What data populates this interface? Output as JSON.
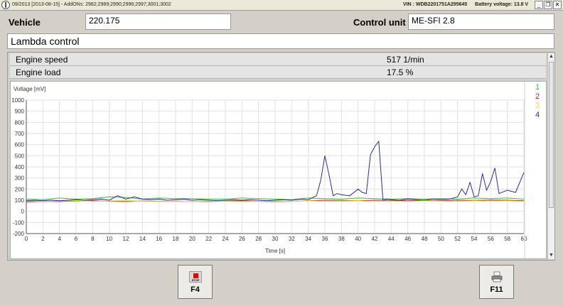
{
  "window": {
    "title": "09/2013 [2013-08-15] - AddONs: 2982;2989;2990;2996;2997;3001;3002",
    "vin": "VIN : WDB2201751A295645",
    "battery": "Battery voltage: 13.8 V"
  },
  "header": {
    "vehicle_label": "Vehicle",
    "vehicle_value": "220.175",
    "control_unit_label": "Control unit",
    "control_unit_value": "ME-SFI 2.8",
    "section_title": "Lambda control"
  },
  "readings": [
    {
      "name": "Engine speed",
      "value": "517 1/min"
    },
    {
      "name": "Engine load",
      "value": "17.5 %"
    }
  ],
  "buttons": {
    "f4_label": "F4",
    "f4_icon_text": "STOP",
    "f11_label": "F11"
  },
  "colors": {
    "series1": "#22cc22",
    "series2": "#cc2222",
    "series3": "#e8e800",
    "series4": "#2a2aa8"
  },
  "chart_data": {
    "type": "line",
    "ylabel": "Voltage [mV]",
    "xlabel": "Time [s]",
    "xlim": [
      0,
      60
    ],
    "ylim": [
      -200,
      1000
    ],
    "x_ticks": [
      0,
      2,
      4,
      6,
      8,
      10,
      12,
      14,
      16,
      18,
      20,
      22,
      24,
      26,
      28,
      30,
      32,
      34,
      36,
      38,
      40,
      42,
      44,
      46,
      48,
      50,
      52,
      54,
      56,
      58,
      60
    ],
    "y_ticks": [
      1000,
      900,
      800,
      700,
      600,
      500,
      400,
      300,
      200,
      100,
      0,
      -100,
      -200
    ],
    "grid": true,
    "legend_position": "right",
    "series": [
      {
        "name": "1",
        "color": "#22cc22",
        "x": [
          0,
          2,
          4,
          6,
          8,
          10,
          12,
          14,
          16,
          18,
          20,
          22,
          24,
          26,
          28,
          30,
          32,
          34,
          36,
          38,
          40,
          42,
          44,
          46,
          48,
          50,
          52,
          54,
          56,
          58,
          60
        ],
        "values": [
          110,
          105,
          120,
          110,
          115,
          130,
          125,
          110,
          120,
          115,
          115,
          110,
          110,
          120,
          115,
          110,
          105,
          120,
          115,
          110,
          120,
          115,
          110,
          115,
          110,
          115,
          110,
          120,
          115,
          120,
          110
        ]
      },
      {
        "name": "2",
        "color": "#cc2222",
        "x": [
          0,
          2,
          4,
          6,
          8,
          10,
          12,
          14,
          16,
          18,
          20,
          22,
          24,
          26,
          28,
          30,
          32,
          34,
          36,
          38,
          40,
          42,
          44,
          46,
          48,
          50,
          52,
          54,
          56,
          58,
          60
        ],
        "values": [
          85,
          90,
          88,
          92,
          95,
          90,
          88,
          92,
          90,
          90,
          90,
          88,
          92,
          95,
          90,
          88,
          90,
          95,
          100,
          98,
          95,
          100,
          98,
          95,
          98,
          95,
          100,
          98,
          102,
          100,
          95
        ]
      },
      {
        "name": "3",
        "color": "#e8e800",
        "x": [
          0,
          2,
          4,
          6,
          8,
          10,
          12,
          14,
          16,
          18,
          20,
          22,
          24,
          26,
          28,
          30,
          32,
          34,
          36,
          38,
          40,
          42,
          44,
          46,
          48,
          50,
          52,
          54,
          56,
          58,
          60
        ],
        "values": [
          95,
          90,
          92,
          95,
          90,
          92,
          95,
          90,
          88,
          92,
          90,
          92,
          90,
          88,
          90,
          92,
          90,
          95,
          90,
          92,
          95,
          90,
          92,
          90,
          95,
          92,
          90,
          95,
          92,
          95,
          90
        ]
      },
      {
        "name": "4",
        "color": "#2a2aa8",
        "x": [
          0,
          1,
          2,
          3,
          4,
          5,
          6,
          7,
          8,
          9,
          10,
          11,
          12,
          13,
          14,
          15,
          16,
          17,
          18,
          19,
          20,
          21,
          22,
          23,
          24,
          25,
          26,
          27,
          28,
          29,
          30,
          31,
          32,
          33,
          34,
          35,
          35.5,
          36,
          36.5,
          37,
          37.5,
          38,
          39,
          40,
          40.5,
          41,
          41.5,
          42,
          42.5,
          43,
          43.5,
          44,
          45,
          46,
          47,
          48,
          49,
          50,
          51,
          52,
          52.5,
          53,
          53.5,
          54,
          54.5,
          55,
          55.5,
          56,
          56.5,
          57,
          58,
          59,
          60
        ],
        "values": [
          95,
          100,
          95,
          100,
          95,
          100,
          105,
          100,
          105,
          110,
          100,
          140,
          110,
          130,
          110,
          105,
          110,
          100,
          105,
          110,
          100,
          105,
          100,
          95,
          100,
          105,
          100,
          105,
          100,
          95,
          100,
          105,
          100,
          110,
          105,
          140,
          280,
          500,
          330,
          140,
          160,
          150,
          140,
          200,
          170,
          160,
          510,
          580,
          630,
          100,
          110,
          105,
          100,
          110,
          105,
          100,
          110,
          105,
          110,
          130,
          200,
          150,
          260,
          130,
          140,
          340,
          190,
          270,
          390,
          160,
          190,
          170,
          350
        ]
      }
    ]
  }
}
